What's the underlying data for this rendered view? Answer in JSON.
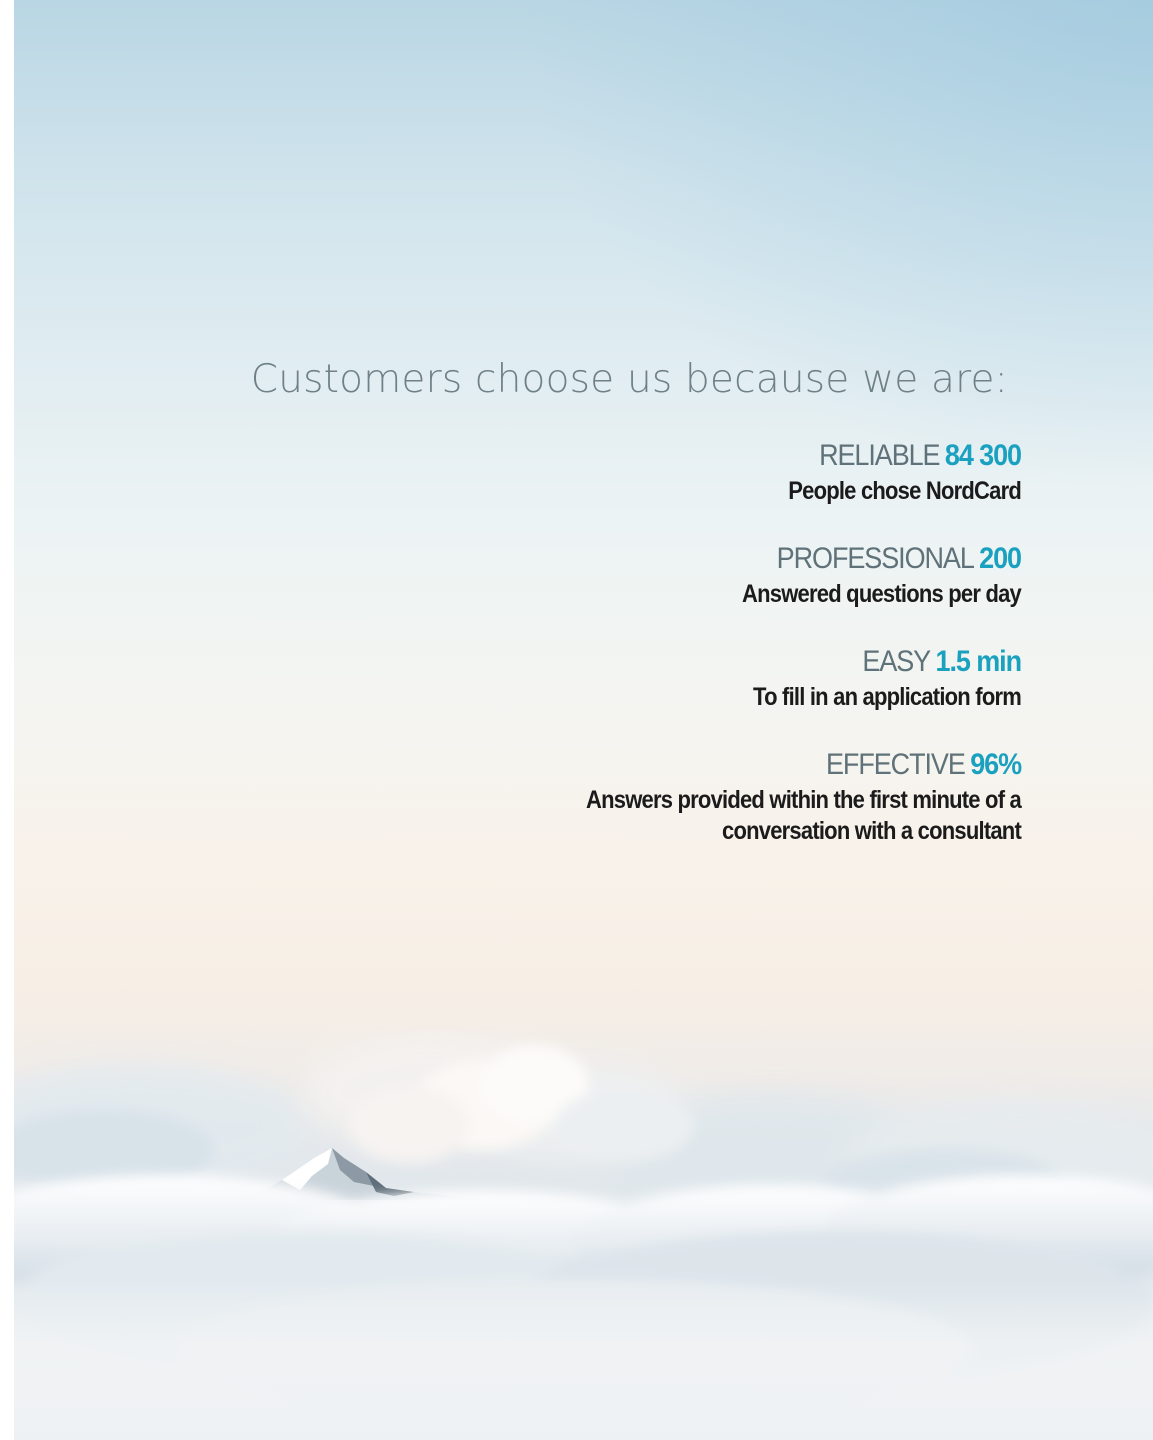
{
  "headline": "Customers choose us because we are:",
  "stats": [
    {
      "label": "RELIABLE",
      "value": "84 300",
      "description": [
        "People chose NordCard"
      ]
    },
    {
      "label": "PROFESSIONAL",
      "value": "200",
      "description": [
        "Answered questions per day"
      ]
    },
    {
      "label": "EASY",
      "value": "1.5 min",
      "description": [
        "To fill in an application form"
      ]
    },
    {
      "label": "EFFECTIVE",
      "value": "96%",
      "description": [
        "Answers provided within the first minute of a",
        "conversation with a consultant"
      ]
    }
  ],
  "colors": {
    "headline": "#6f8187",
    "label": "#5f7279",
    "accent": "#1ba1c0",
    "description": "#1b1b1b"
  }
}
